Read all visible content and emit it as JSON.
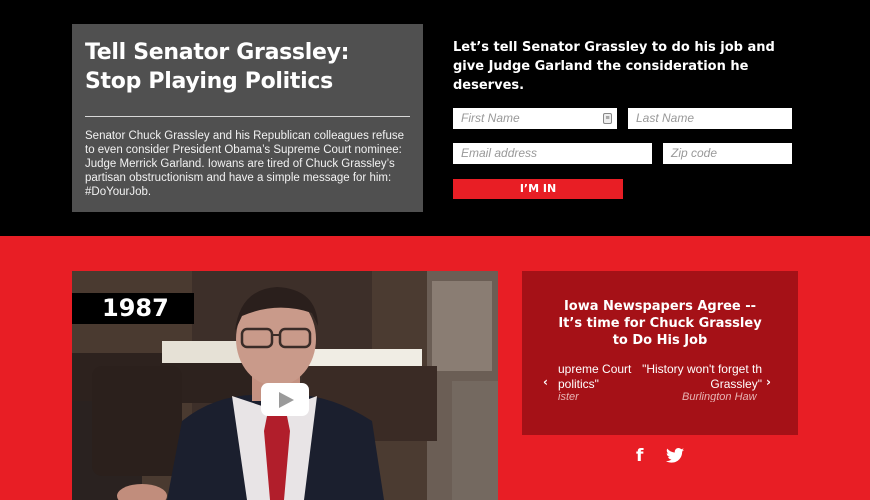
{
  "intro": {
    "title_line1": "Tell Senator Grassley:",
    "title_line2": "Stop Playing Politics",
    "body": "Senator Chuck Grassley and his Republican colleagues refuse to even consider President Obama’s Supreme Court nominee: Judge Merrick Garland. Iowans are tired of Chuck Grassley’s partisan obstructionism and have a simple message for him: #DoYourJob."
  },
  "form": {
    "heading": "Let’s tell Senator Grassley to do his job and give Judge Garland the consideration he deserves.",
    "first_name_placeholder": "First Name",
    "last_name_placeholder": "Last Name",
    "email_placeholder": "Email address",
    "zip_placeholder": "Zip code",
    "submit_label": "I’M IN"
  },
  "video": {
    "year": "1987"
  },
  "news": {
    "title_line1": "Iowa Newspapers Agree --",
    "title_line2": "It’s time for Chuck Grassley",
    "title_line3": "to Do His Job",
    "quote1_line1": "upreme Court",
    "quote1_line2": "politics\"",
    "quote1_source": "ister",
    "quote2_line1": "\"History won't forget th",
    "quote2_line2": "Grassley\"",
    "quote2_source": "Burlington Haw",
    "prev_arrow": "‹",
    "next_arrow": "›"
  },
  "social": {
    "facebook_icon": "f",
    "twitter_icon": "twitter-bird"
  }
}
